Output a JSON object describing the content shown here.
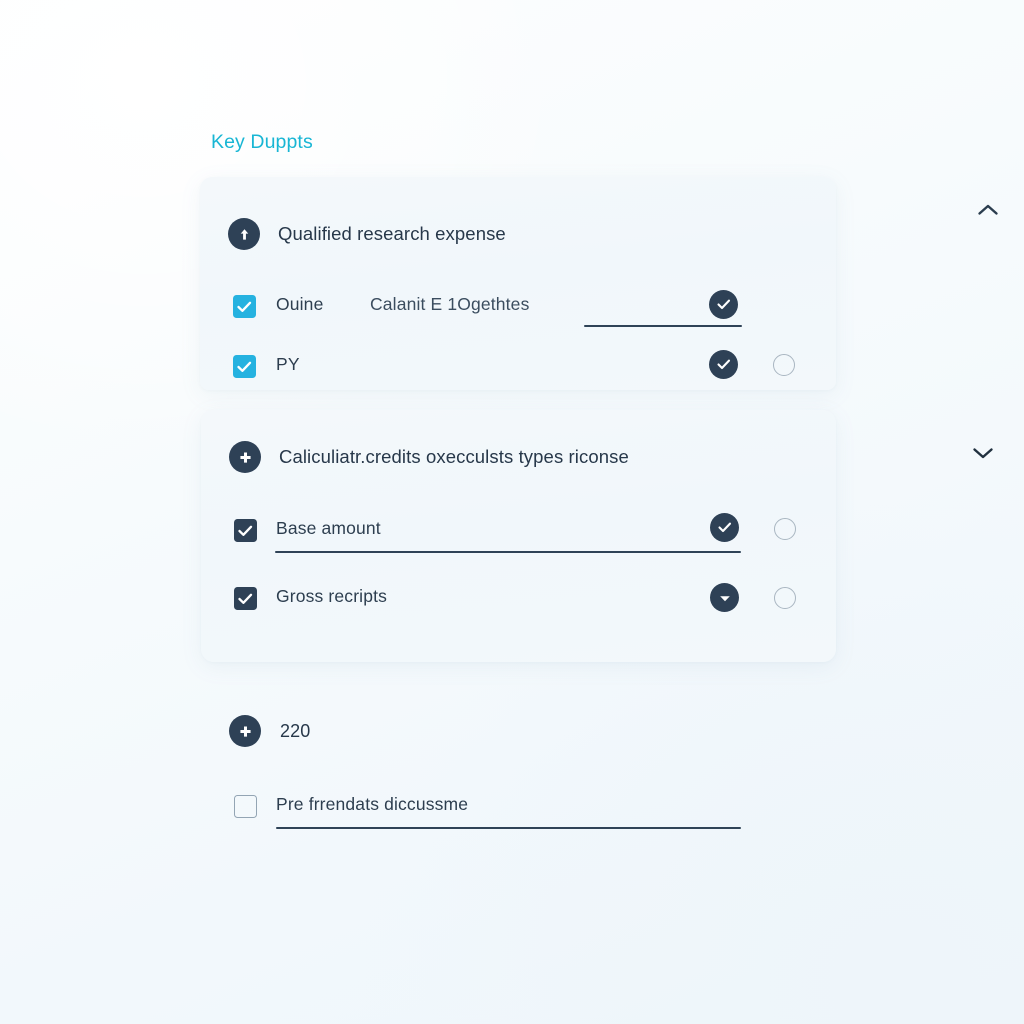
{
  "page": {
    "heading": "Key Duppts",
    "accent_color": "#18b6d4",
    "navy_color": "#2e4156",
    "cyan_color": "#25b2e0",
    "background_color": "#f4f9fc"
  },
  "cards": [
    {
      "id": "qualified-research-expense",
      "icon": "arrow-up-circle-icon",
      "title": "Qualified research expense",
      "expanded": true,
      "chevron": "chevron-up-icon",
      "rows": [
        {
          "checkbox": "checked",
          "checkbox_color": "cyan",
          "label": "Ouine",
          "secondary_label": "Calanit E 1Ogethtes",
          "has_underline": true,
          "badge": "check-badge",
          "has_radio": false
        },
        {
          "checkbox": "checked",
          "checkbox_color": "cyan",
          "label": "PY",
          "secondary_label": "",
          "has_underline": false,
          "badge": "check-badge",
          "has_radio": true
        }
      ]
    },
    {
      "id": "calculate-credits",
      "icon": "plus-circle-icon",
      "title": "Caliculiatr.credits oxecculsts types riconse",
      "expanded": false,
      "chevron": "chevron-down-icon",
      "rows": [
        {
          "checkbox": "checked",
          "checkbox_color": "navy",
          "label": "Base amount",
          "secondary_label": "",
          "has_underline": true,
          "badge": "check-badge",
          "has_radio": true
        },
        {
          "checkbox": "checked",
          "checkbox_color": "navy",
          "label": "Gross recripts",
          "secondary_label": "",
          "has_underline": false,
          "badge": "caret-down-badge",
          "has_radio": true
        }
      ]
    }
  ],
  "footer": {
    "add_icon": "plus-circle-icon",
    "add_label": "220",
    "note_checkbox": "unchecked",
    "note_label": "Pre frrendats diccussme",
    "note_has_underline": true
  }
}
